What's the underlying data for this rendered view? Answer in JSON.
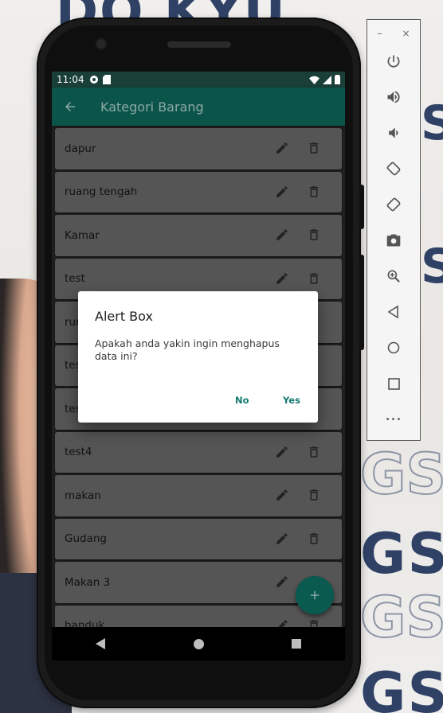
{
  "statusbar": {
    "time": "11:04"
  },
  "appbar": {
    "title": "Kategori Barang",
    "back_icon": "arrow-back-icon"
  },
  "list": {
    "items": [
      {
        "label": "dapur"
      },
      {
        "label": "ruang tengah"
      },
      {
        "label": "Kamar"
      },
      {
        "label": "test"
      },
      {
        "label": "run"
      },
      {
        "label": "tes"
      },
      {
        "label": "tes"
      },
      {
        "label": "test4"
      },
      {
        "label": "makan"
      },
      {
        "label": "Gudang"
      },
      {
        "label": "Makan 3"
      },
      {
        "label": "handuk"
      }
    ]
  },
  "dialog": {
    "title": "Alert Box",
    "message": "Apakah anda yakin ingin menghapus data ini?",
    "no_label": "No",
    "yes_label": "Yes"
  },
  "fab": {
    "icon": "add-icon"
  },
  "toolbar": {
    "minimize_label": "–",
    "close_label": "×",
    "more_label": "•••"
  },
  "colors": {
    "appbar": "#0b544a",
    "accent": "#137a6f",
    "fab": "#0a5a50"
  }
}
